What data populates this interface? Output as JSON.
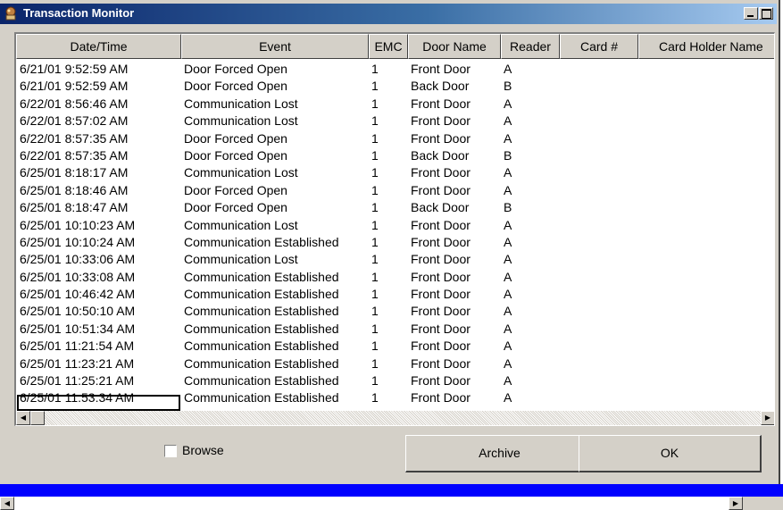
{
  "window": {
    "title": "Transaction Monitor"
  },
  "columns": [
    "Date/Time",
    "Event",
    "EMC",
    "Door Name",
    "Reader",
    "Card #",
    "Card Holder Name"
  ],
  "rows": [
    {
      "date": "6/21/01 9:52:59 AM",
      "event": "Door Forced Open",
      "emc": "1",
      "door": "Front Door",
      "reader": "A"
    },
    {
      "date": "6/21/01 9:52:59 AM",
      "event": "Door Forced Open",
      "emc": "1",
      "door": "Back Door",
      "reader": "B"
    },
    {
      "date": "6/22/01 8:56:46 AM",
      "event": "Communication Lost",
      "emc": "1",
      "door": "Front Door",
      "reader": "A"
    },
    {
      "date": "6/22/01 8:57:02 AM",
      "event": "Communication Lost",
      "emc": "1",
      "door": "Front Door",
      "reader": "A"
    },
    {
      "date": "6/22/01 8:57:35 AM",
      "event": "Door Forced Open",
      "emc": "1",
      "door": "Front Door",
      "reader": "A"
    },
    {
      "date": "6/22/01 8:57:35 AM",
      "event": "Door Forced Open",
      "emc": "1",
      "door": "Back Door",
      "reader": "B"
    },
    {
      "date": "6/25/01 8:18:17 AM",
      "event": "Communication Lost",
      "emc": "1",
      "door": "Front Door",
      "reader": "A"
    },
    {
      "date": "6/25/01 8:18:46 AM",
      "event": "Door Forced Open",
      "emc": "1",
      "door": "Front Door",
      "reader": "A"
    },
    {
      "date": "6/25/01 8:18:47 AM",
      "event": "Door Forced Open",
      "emc": "1",
      "door": "Back Door",
      "reader": "B"
    },
    {
      "date": "6/25/01 10:10:23 AM",
      "event": "Communication Lost",
      "emc": "1",
      "door": "Front Door",
      "reader": "A"
    },
    {
      "date": "6/25/01 10:10:24 AM",
      "event": "Communication Established",
      "emc": "1",
      "door": "Front Door",
      "reader": "A"
    },
    {
      "date": "6/25/01 10:33:06 AM",
      "event": "Communication Lost",
      "emc": "1",
      "door": "Front Door",
      "reader": "A"
    },
    {
      "date": "6/25/01 10:33:08 AM",
      "event": "Communication Established",
      "emc": "1",
      "door": "Front Door",
      "reader": "A"
    },
    {
      "date": "6/25/01 10:46:42 AM",
      "event": "Communication Established",
      "emc": "1",
      "door": "Front Door",
      "reader": "A"
    },
    {
      "date": "6/25/01 10:50:10 AM",
      "event": "Communication Established",
      "emc": "1",
      "door": "Front Door",
      "reader": "A"
    },
    {
      "date": "6/25/01 10:51:34 AM",
      "event": "Communication Established",
      "emc": "1",
      "door": "Front Door",
      "reader": "A"
    },
    {
      "date": "6/25/01 11:21:54 AM",
      "event": "Communication Established",
      "emc": "1",
      "door": "Front Door",
      "reader": "A"
    },
    {
      "date": "6/25/01 11:23:21 AM",
      "event": "Communication Established",
      "emc": "1",
      "door": "Front Door",
      "reader": "A"
    },
    {
      "date": "6/25/01 11:25:21 AM",
      "event": "Communication Established",
      "emc": "1",
      "door": "Front Door",
      "reader": "A"
    },
    {
      "date": "6/25/01 11:53:34 AM",
      "event": "Communication Established",
      "emc": "1",
      "door": "Front Door",
      "reader": "A"
    }
  ],
  "controls": {
    "browse_label": "Browse",
    "browse_checked": false,
    "archive_label": "Archive",
    "ok_label": "OK"
  },
  "icons": {
    "title": "app-icon",
    "minimize": "minimize-icon",
    "maximize": "maximize-icon",
    "scroll_left": "scroll-left-icon",
    "scroll_right": "scroll-right-icon"
  },
  "colors": {
    "titlebar_start": "#0a246a",
    "titlebar_end": "#a6caf0",
    "face": "#d4d0c8",
    "status_bar": "#0000ff"
  }
}
